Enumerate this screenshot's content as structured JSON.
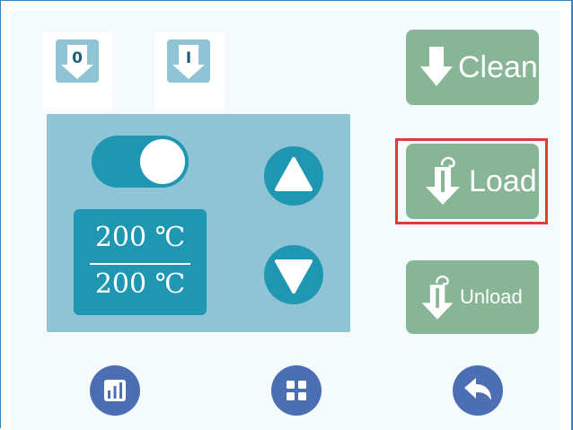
{
  "extruders": [
    {
      "label": "0"
    },
    {
      "label": "I"
    }
  ],
  "heater": {
    "enabled": true,
    "current_temp": "200 ℃",
    "target_temp": "200 ℃"
  },
  "actions": {
    "clean_label": "Clean",
    "load_label": "Load",
    "unload_label": "Unload",
    "highlighted": "load"
  },
  "icons": {
    "nav_left": "bar-chart-icon",
    "nav_middle": "grid-icon",
    "nav_right": "back-arrow-icon"
  },
  "colors": {
    "panel": "#8ec4d3",
    "accent": "#1f97b3",
    "action_button": "#87b596",
    "nav_button": "#4c6fb3",
    "highlight": "#e23a3a"
  }
}
